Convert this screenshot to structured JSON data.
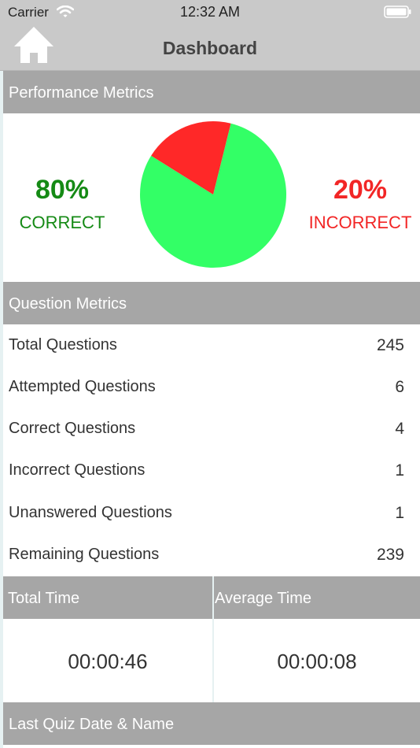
{
  "status_bar": {
    "carrier": "Carrier",
    "time": "12:32 AM"
  },
  "navbar": {
    "title": "Dashboard",
    "home_icon": "home-icon"
  },
  "performance": {
    "header": "Performance Metrics",
    "correct_percent": "80%",
    "correct_label": "CORRECT",
    "incorrect_percent": "20%",
    "incorrect_label": "INCORRECT",
    "correct_fraction": 0.8,
    "incorrect_fraction": 0.2,
    "correct_color": "#33ff66",
    "incorrect_color": "#ff2828"
  },
  "questions": {
    "header": "Question Metrics",
    "rows": [
      {
        "label": "Total Questions",
        "value": "245"
      },
      {
        "label": "Attempted Questions",
        "value": "6"
      },
      {
        "label": "Correct Questions",
        "value": "4"
      },
      {
        "label": "Incorrect Questions",
        "value": "1"
      },
      {
        "label": "Unanswered Questions",
        "value": "1"
      },
      {
        "label": "Remaining Questions",
        "value": "239"
      }
    ]
  },
  "time": {
    "total_label": "Total Time",
    "total_value": "00:00:46",
    "average_label": "Average Time",
    "average_value": "00:00:08"
  },
  "last_quiz": {
    "header": "Last Quiz Date & Name"
  }
}
